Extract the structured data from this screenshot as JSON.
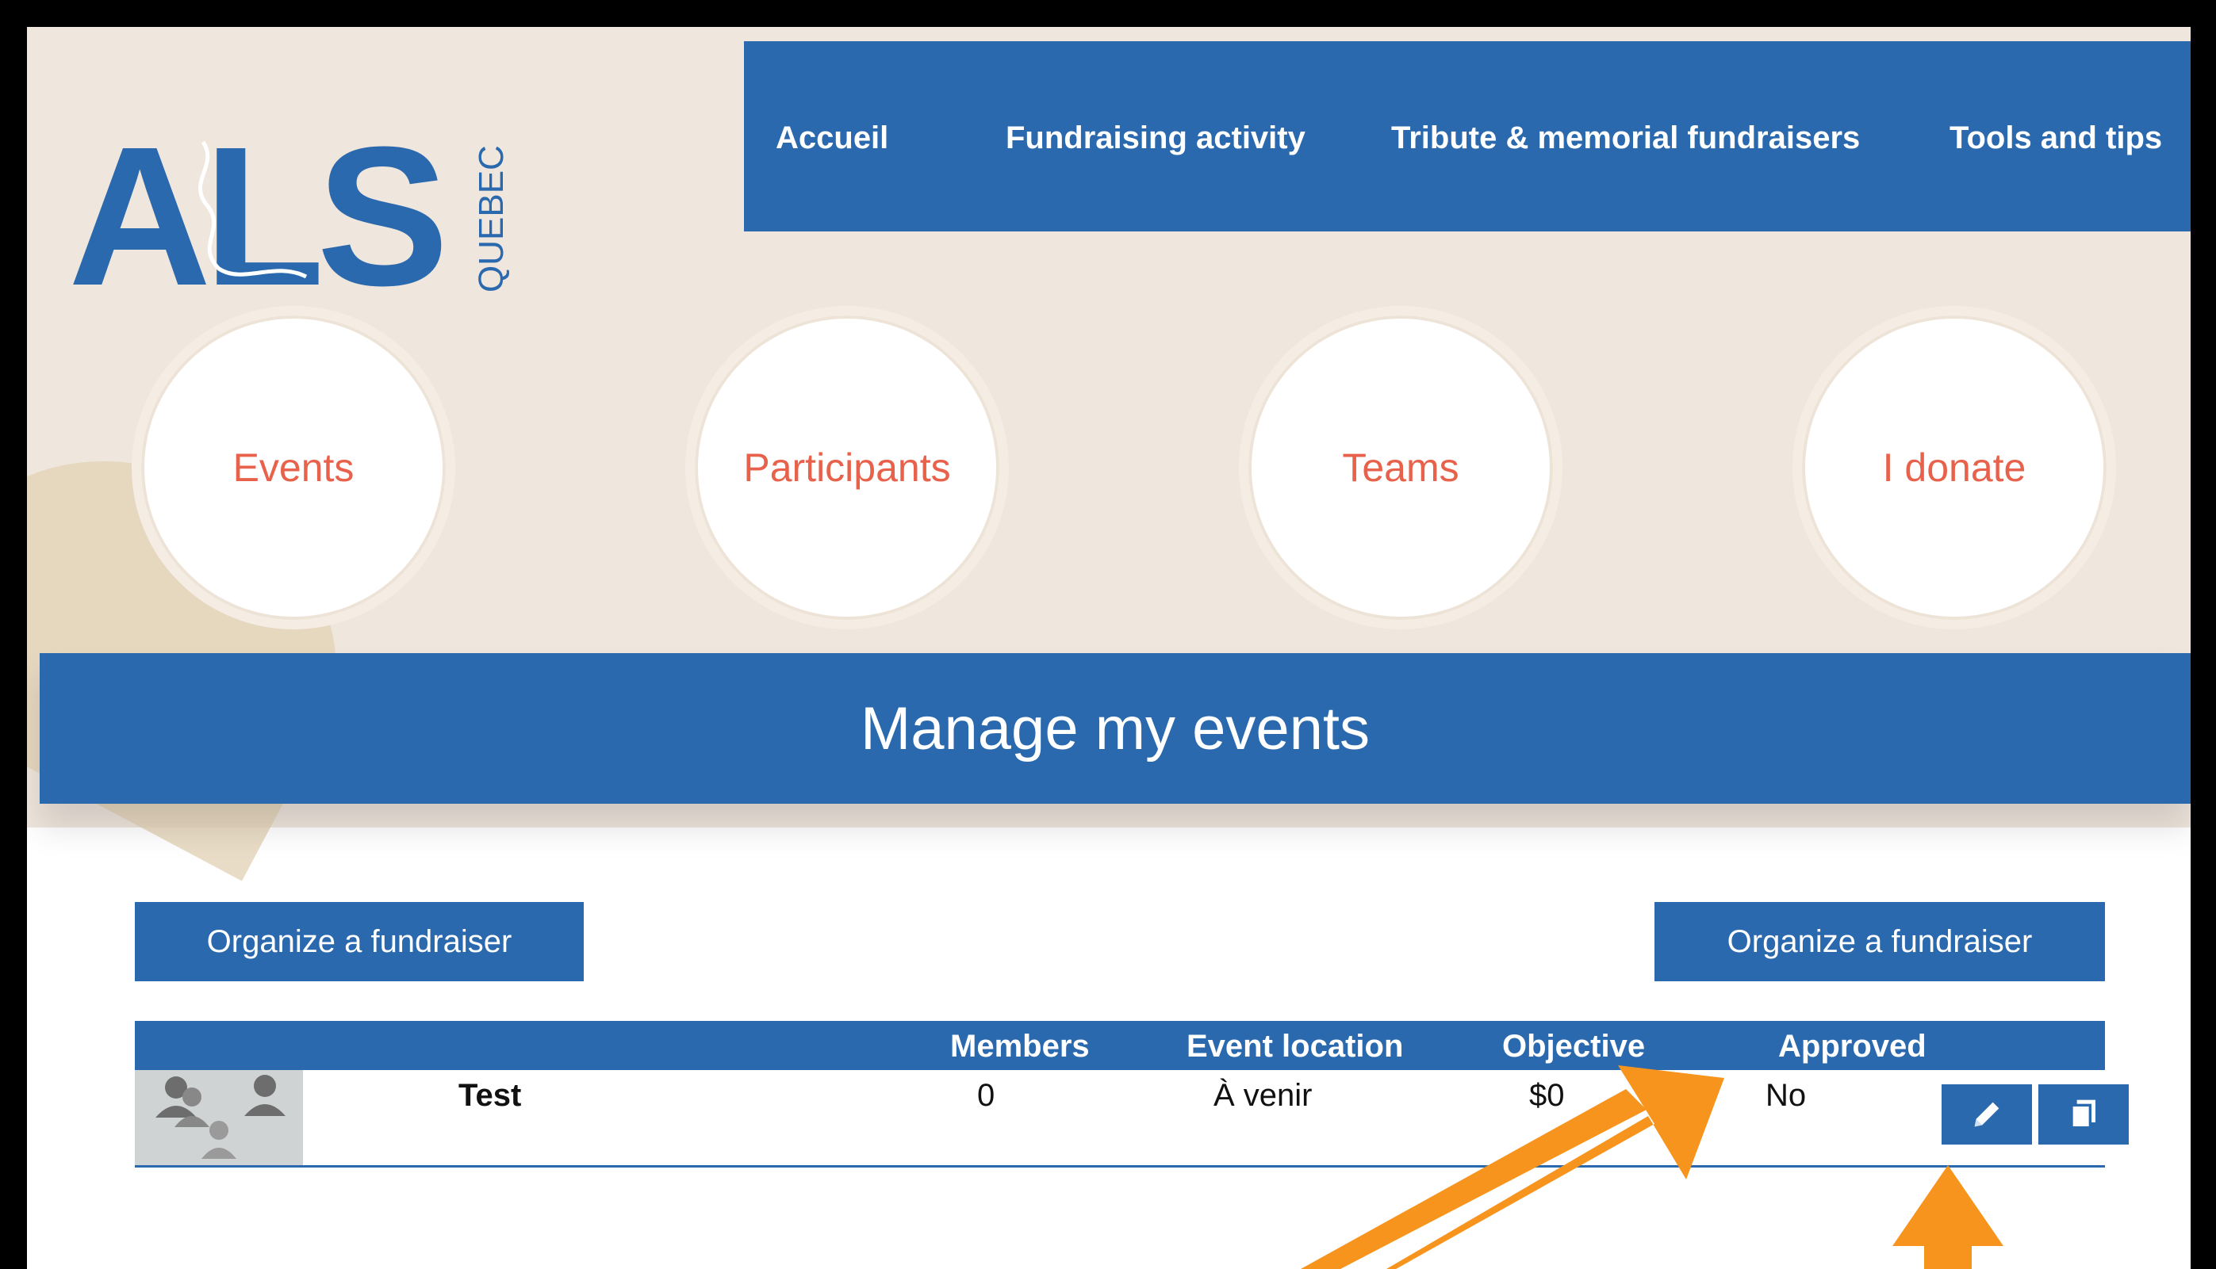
{
  "logo": {
    "text": "ALS",
    "side_text": "QUEBEC",
    "brand_color": "#2b69ae"
  },
  "nav": {
    "items": [
      "Accueil",
      "Fundraising activity",
      "Tribute & memorial fundraisers",
      "Tools and tips"
    ]
  },
  "circles": [
    "Events",
    "Participants",
    "Teams",
    "I donate"
  ],
  "page_title": "Manage my events",
  "buttons": {
    "organize_left": "Organize a fundraiser",
    "organize_right": "Organize a fundraiser"
  },
  "table": {
    "headers": [
      "Members",
      "Event location",
      "Objective",
      "Approved"
    ],
    "rows": [
      {
        "name": "Test",
        "members": "0",
        "location": "À venir",
        "objective": "$0",
        "approved": "No"
      }
    ]
  },
  "icons": {
    "edit": "pencil-icon",
    "copy": "copy-icon",
    "avatar": "group-avatar-icon"
  },
  "colors": {
    "accent": "#2b69ae",
    "circle_text": "#e8614a",
    "annotation_arrow": "#f7941d"
  }
}
